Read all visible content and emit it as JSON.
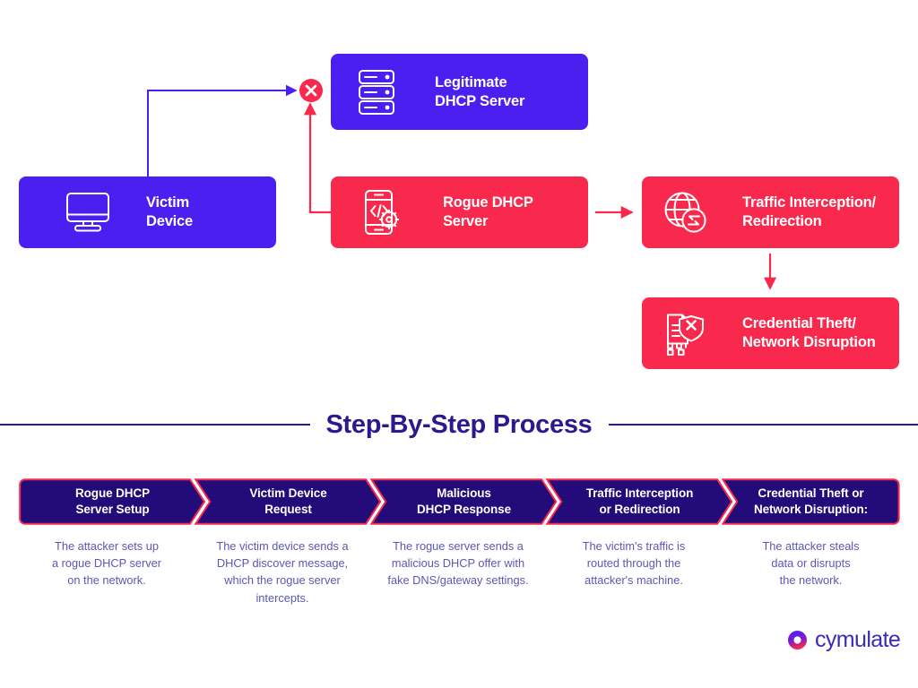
{
  "colors": {
    "purple": "#4b1ff0",
    "red": "#f8294c",
    "navy": "#2b1a8e",
    "chevron_fill": "#230b7a",
    "chevron_stroke": "#f8294c",
    "desc_text": "#5b57b5",
    "logo_text": "#3b2bb5",
    "white": "#ffffff"
  },
  "diagram": {
    "nodes": [
      {
        "id": "legitimate-dhcp-server",
        "label": "Legitimate\nDHCP Server",
        "icon": "server-stack-icon",
        "color": "#4b1ff0"
      },
      {
        "id": "victim-device",
        "label": "Victim\nDevice",
        "icon": "desktop-monitor-icon",
        "color": "#4b1ff0"
      },
      {
        "id": "rogue-dhcp-server",
        "label": "Rogue DHCP\nServer",
        "icon": "mobile-code-gear-icon",
        "color": "#f8294c"
      },
      {
        "id": "traffic-interception",
        "label": "Traffic Interception/\nRedirection",
        "icon": "globe-redirect-icon",
        "color": "#f8294c"
      },
      {
        "id": "credential-theft",
        "label": "Credential Theft/\nNetwork Disruption",
        "icon": "document-shield-x-icon",
        "color": "#f8294c"
      }
    ],
    "markers": [
      {
        "id": "blocked-marker",
        "icon": "circle-x-icon",
        "color": "#f8294c"
      }
    ]
  },
  "section": {
    "heading": "Step-By-Step Process"
  },
  "steps": [
    {
      "title": "Rogue DHCP\nServer Setup",
      "description": "The attacker sets up\na rogue DHCP server\non the network."
    },
    {
      "title": "Victim Device\nRequest",
      "description": "The victim device sends a\nDHCP discover message,\nwhich the rogue server\nintercepts."
    },
    {
      "title": "Malicious\nDHCP Response",
      "description": "The rogue server sends a\nmalicious DHCP offer with\nfake DNS/gateway settings."
    },
    {
      "title": "Traffic Interception\nor Redirection",
      "description": "The victim's traffic is\nrouted through the\nattacker's machine."
    },
    {
      "title": "Credential Theft or\nNetwork Disruption:",
      "description": "The attacker steals\ndata or disrupts\nthe network."
    }
  ],
  "logo": {
    "text": "cymulate",
    "mark": "cymulate-ring-icon"
  }
}
